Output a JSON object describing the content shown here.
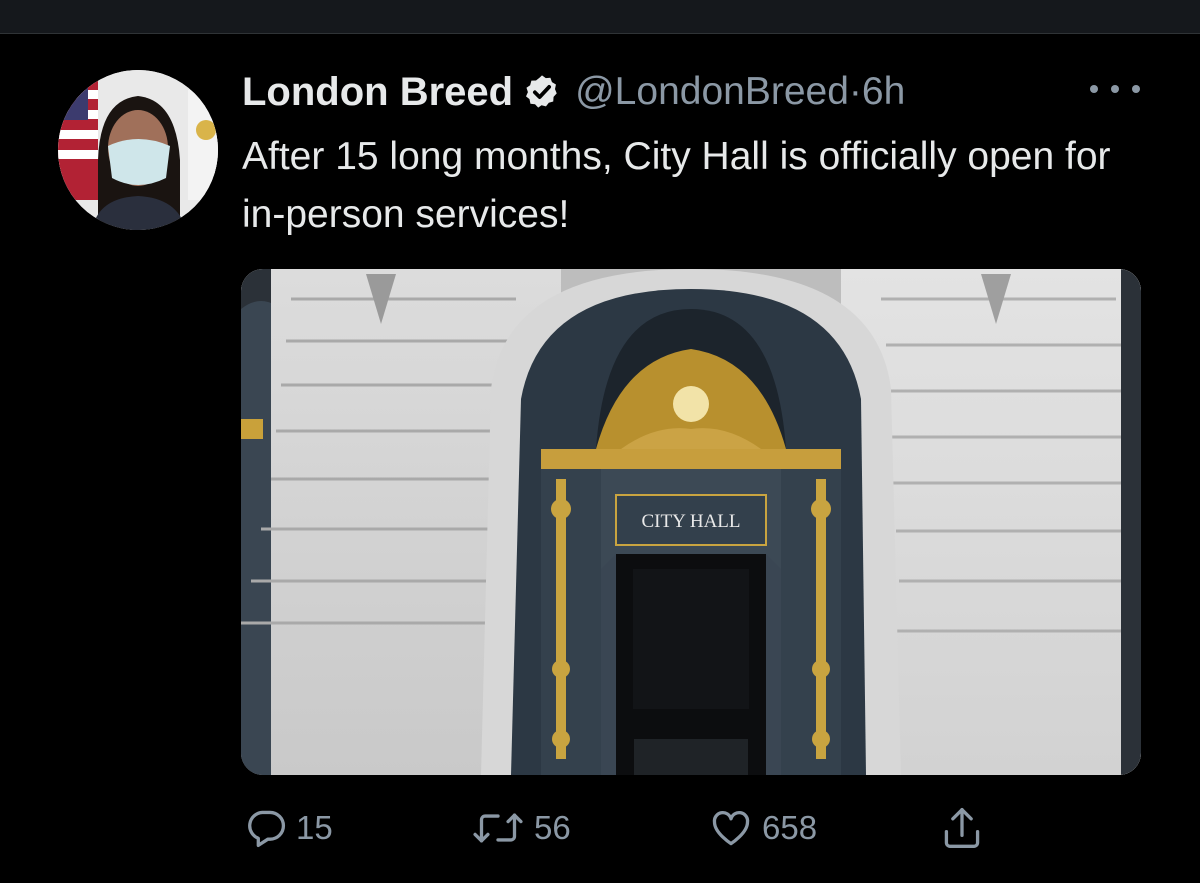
{
  "tweet": {
    "display_name": "London Breed",
    "handle": "@LondonBreed",
    "separator": "·",
    "time": "6h",
    "text": "After 15 long months, City Hall is officially open for in-person services!",
    "media": {
      "sign_text": "CITY HALL"
    },
    "stats": {
      "replies": "15",
      "retweets": "56",
      "likes": "658"
    }
  },
  "icons": {
    "verified": "verified-badge-icon",
    "more": "more-options-icon",
    "reply": "reply-icon",
    "retweet": "retweet-icon",
    "like": "heart-icon",
    "share": "share-icon"
  },
  "colors": {
    "background": "#000000",
    "primary_text": "#e7e9ea",
    "secondary_text": "#8b98a5",
    "top_bar": "#15181c"
  }
}
